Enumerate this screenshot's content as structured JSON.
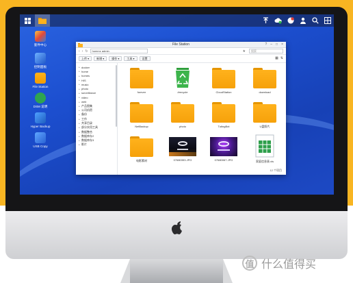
{
  "taskbar": {
    "right_icons": [
      "upload-icon",
      "cloud-icon",
      "chat-icon",
      "user-icon",
      "search-icon",
      "widgets-icon"
    ]
  },
  "desktop": {
    "icons": [
      {
        "label": "套件中心",
        "icon": "package-center-icon",
        "color": "#e24a3b"
      },
      {
        "label": "控制面板",
        "icon": "control-panel-icon",
        "color": "#3a7bd5"
      },
      {
        "label": "File Station",
        "icon": "file-station-icon",
        "color": "#f5a300"
      },
      {
        "label": "DSM 说明",
        "icon": "help-icon",
        "color": "#2fa44f"
      },
      {
        "label": "Hyper Backup",
        "icon": "hyper-backup-icon",
        "color": "#1f6fcf"
      },
      {
        "label": "USB Copy",
        "icon": "usb-copy-icon",
        "color": "#2d6fd8"
      }
    ]
  },
  "window": {
    "title": "File Station",
    "path": "home ▸ admin",
    "search_placeholder": "搜索",
    "toolbar": [
      "上传 ▾",
      "新增 ▾",
      "操作 ▾",
      "工具 ▾",
      "设置"
    ],
    "tree": [
      {
        "label": "docker",
        "selected": false
      },
      {
        "label": "home",
        "selected": false
      },
      {
        "label": "homes",
        "selected": false
      },
      {
        "label": "HIS",
        "selected": false
      },
      {
        "label": "music",
        "selected": false
      },
      {
        "label": "photo",
        "selected": false
      },
      {
        "label": "surveillance",
        "selected": false
      },
      {
        "label": "video",
        "selected": false
      },
      {
        "label": "web",
        "selected": false
      },
      {
        "label": "产品图集",
        "selected": false
      },
      {
        "label": "公司机密",
        "selected": false
      },
      {
        "label": "备份",
        "selected": false
      },
      {
        "label": "工作",
        "selected": false
      },
      {
        "label": "共享目录",
        "selected": false
      },
      {
        "label": "部分实用工具",
        "selected": false
      },
      {
        "label": "数据整合",
        "selected": false
      },
      {
        "label": "数据库存2",
        "selected": false
      },
      {
        "label": "数据库存3",
        "selected": false
      },
      {
        "label": "影片",
        "selected": false
      }
    ],
    "files": [
      {
        "label": "forever",
        "type": "folder"
      },
      {
        "label": "#recycle",
        "type": "recycle"
      },
      {
        "label": "CloudStation",
        "type": "folder"
      },
      {
        "label": "download",
        "type": "folder"
      },
      {
        "label": "NetBackup",
        "type": "folder"
      },
      {
        "label": "photo",
        "type": "folder"
      },
      {
        "label": "TutingBot",
        "type": "folder"
      },
      {
        "label": "U盘照片",
        "type": "folder"
      },
      {
        "label": "电影素材",
        "type": "folder"
      },
      {
        "label": "07680353.JPG",
        "type": "image-a"
      },
      {
        "label": "07680067.JPG",
        "type": "image-b"
      },
      {
        "label": "家庭信息表.xls",
        "type": "sheet"
      }
    ],
    "status": "12 个项目"
  },
  "watermark": {
    "text": "什么值得买",
    "mark": "值"
  }
}
